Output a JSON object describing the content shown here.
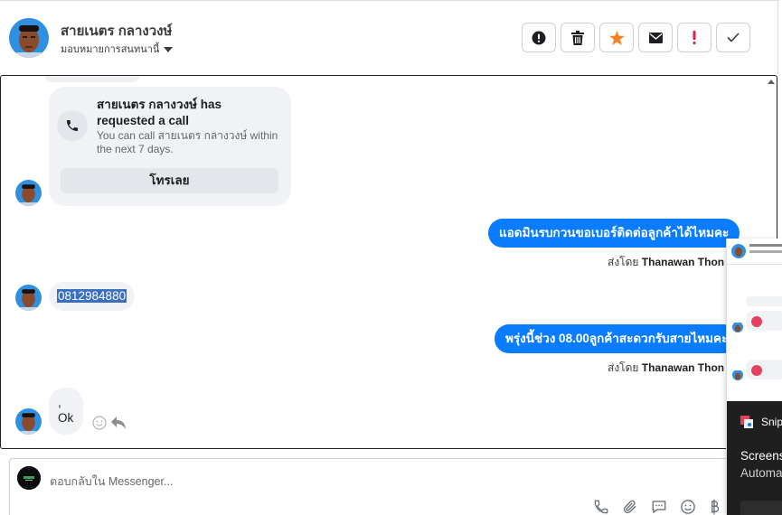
{
  "header": {
    "contact_name": "สายเนตร กลางวงษ์",
    "assign_label": "มอบหมายการสนทนานี้",
    "actions": [
      {
        "icon": "alert-circle-icon",
        "name": "mark-spam-button"
      },
      {
        "icon": "trash-icon",
        "name": "delete-button"
      },
      {
        "icon": "star-icon",
        "name": "star-button"
      },
      {
        "icon": "envelope-icon",
        "name": "mark-unread-button"
      },
      {
        "icon": "exclamation-icon",
        "name": "flag-button"
      },
      {
        "icon": "check-icon",
        "name": "mark-done-button"
      }
    ]
  },
  "messages": {
    "call_request": {
      "title": "สายเนตร กลางวงษ์ has requested a call",
      "description": "You can call สายเนตร กลางวงษ์ within the next 7 days.",
      "button_label": "โทรเลย"
    },
    "outgoing_1": {
      "text": "แอดมินรบกวนขอเบอร์ติดต่อลูกค้าได้ไหมคะ",
      "sent_by_prefix": "ส่งโดย",
      "sent_by_name": "Thanawan Thon"
    },
    "incoming_phone": {
      "text": "0812984880"
    },
    "outgoing_2": {
      "text": "พรุ่งนี้ช่วง 08.00ลูกค้าสะดวกรับสายไหมคะ",
      "sent_by_prefix": "ส่งโดย",
      "sent_by_name": "Thanawan Thon"
    },
    "incoming_ok": {
      "line1": ",",
      "line2": "Ok"
    }
  },
  "composer": {
    "placeholder": "ตอบกลับใน Messenger..."
  },
  "overlay": {
    "snip_title": "Snip",
    "body_line1": "Screens",
    "body_line2": "Automa"
  },
  "colors": {
    "accent": "#0a7cff",
    "star": "#f5821f",
    "flag": "#e41e3f",
    "missed_call": "#e4405f",
    "selection": "#3b6fbf"
  }
}
